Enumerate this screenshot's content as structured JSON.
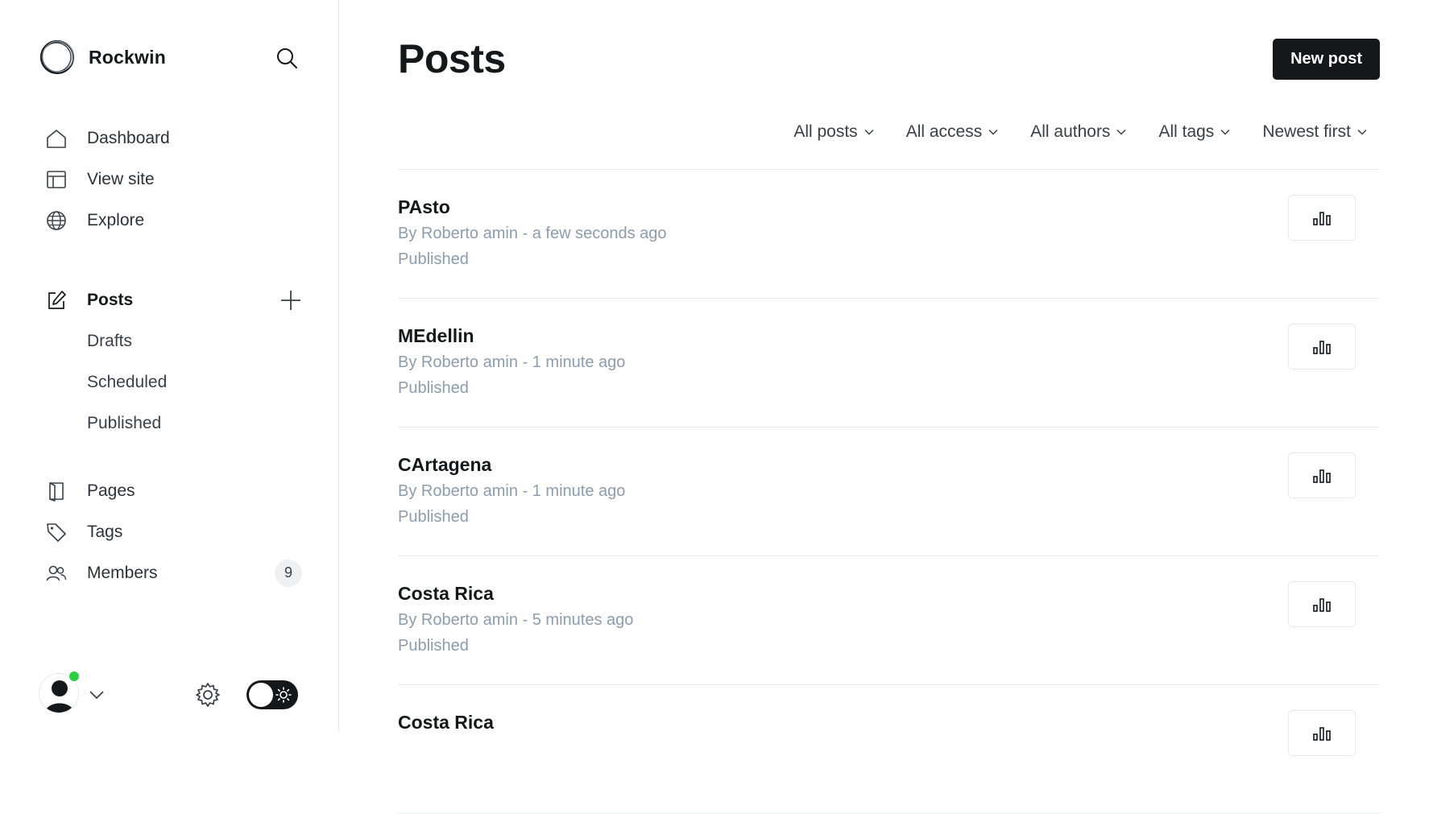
{
  "brand": {
    "name": "Rockwin",
    "logo_icon": "ghost-logo-ring-icon"
  },
  "sidebar": {
    "nav_top": [
      {
        "label": "Dashboard",
        "icon": "home-icon"
      },
      {
        "label": "View site",
        "icon": "layout-icon"
      },
      {
        "label": "Explore",
        "icon": "globe-icon"
      }
    ],
    "posts": {
      "label": "Posts",
      "icon": "edit-icon",
      "sub_items": [
        "Drafts",
        "Scheduled",
        "Published"
      ]
    },
    "nav_bottom": [
      {
        "label": "Pages",
        "icon": "page-icon"
      },
      {
        "label": "Tags",
        "icon": "tag-icon"
      },
      {
        "label": "Members",
        "icon": "members-icon",
        "badge": "9"
      }
    ]
  },
  "main": {
    "title": "Posts",
    "new_post_label": "New post",
    "filters": [
      "All posts",
      "All access",
      "All authors",
      "All tags",
      "Newest first"
    ],
    "posts": [
      {
        "title": "PAsto",
        "meta": "By Roberto amin - a few seconds ago",
        "status": "Published"
      },
      {
        "title": "MEdellin",
        "meta": "By Roberto amin - 1 minute ago",
        "status": "Published"
      },
      {
        "title": "CArtagena",
        "meta": "By Roberto amin - 1 minute ago",
        "status": "Published"
      },
      {
        "title": "Costa Rica",
        "meta": "By Roberto amin - 5 minutes ago",
        "status": "Published"
      },
      {
        "title": "Costa Rica",
        "meta": "",
        "status": ""
      }
    ]
  },
  "colors": {
    "accent_dark": "#15171a",
    "muted_text": "#8e9cac",
    "online_dot": "#30cf43"
  }
}
